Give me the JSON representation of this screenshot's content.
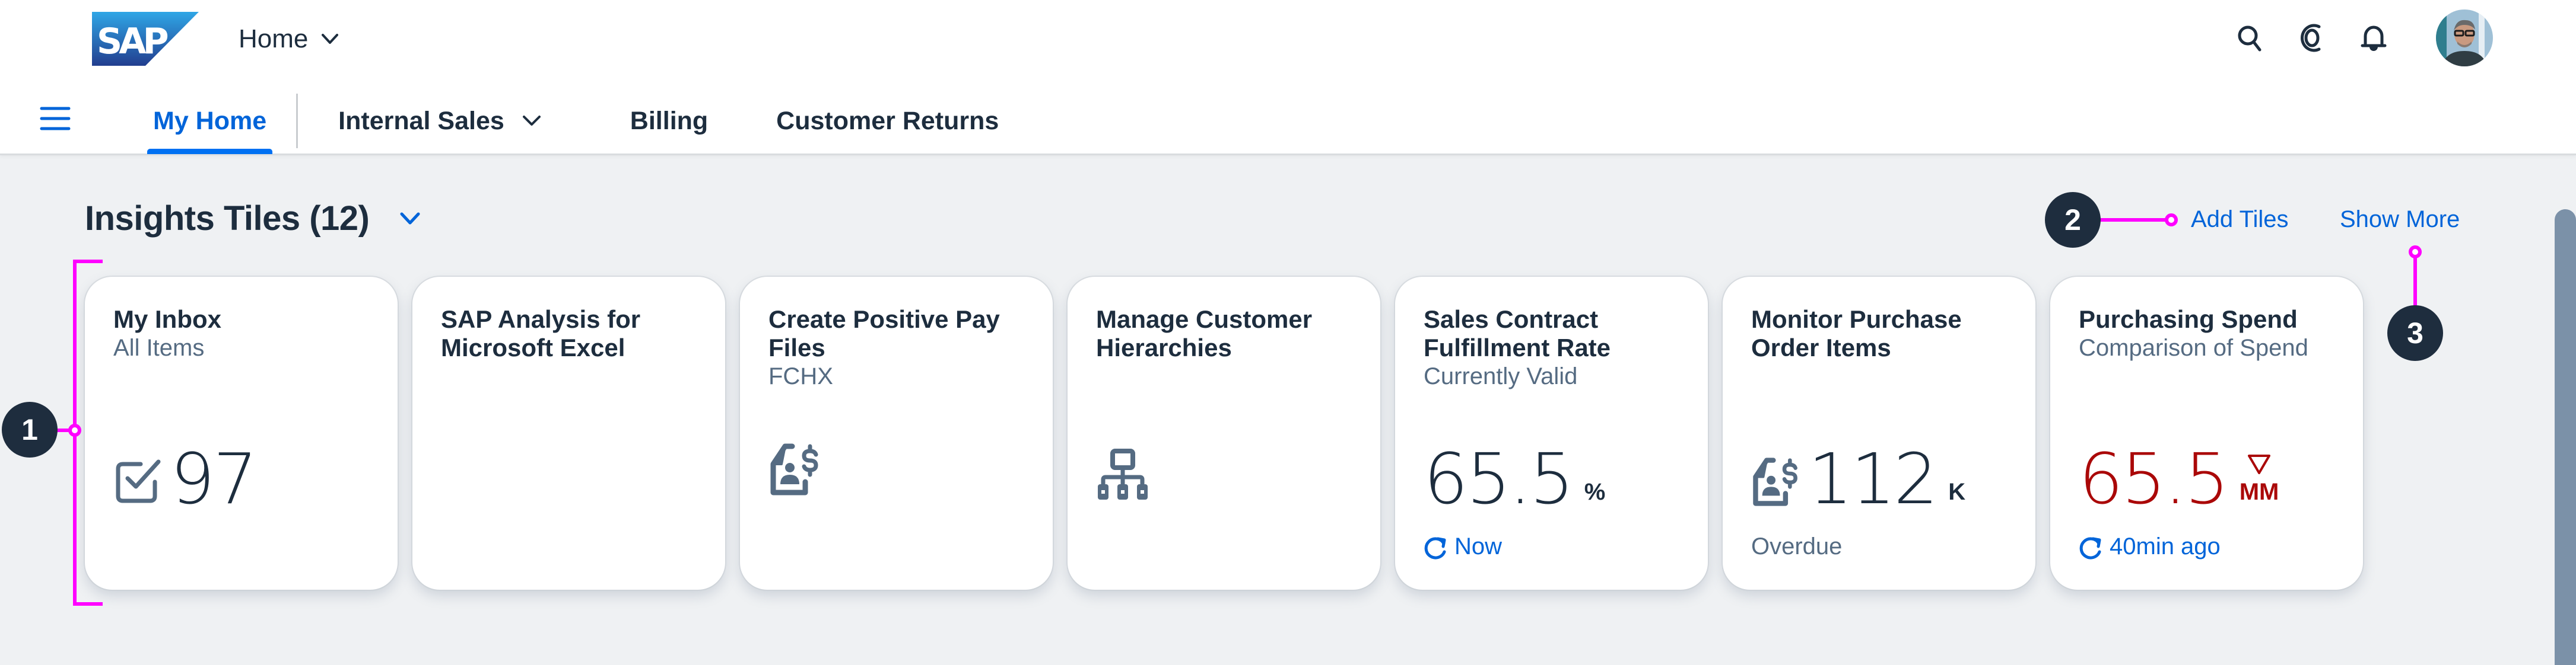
{
  "shell": {
    "logo": "SAP",
    "home_menu_label": "Home",
    "actions": [
      {
        "name": "search",
        "icon": "search-icon"
      },
      {
        "name": "joule",
        "icon": "joule-copilot-icon"
      },
      {
        "name": "notifications",
        "icon": "bell-icon"
      },
      {
        "name": "profile",
        "icon": "user-avatar"
      }
    ]
  },
  "nav": {
    "menu_icon": "hamburger-icon",
    "tabs": [
      {
        "label": "My Home",
        "active": true
      },
      {
        "label": "Internal Sales",
        "has_dropdown": true
      },
      {
        "label": "Billing"
      },
      {
        "label": "Customer Returns"
      }
    ]
  },
  "section": {
    "title": "Insights Tiles (12)",
    "add_tiles_label": "Add Tiles",
    "show_more_label": "Show More"
  },
  "tiles": [
    {
      "title": "My Inbox",
      "subtitle": "All Items",
      "icon": "checkbox-checked-icon",
      "value": "97"
    },
    {
      "title": "SAP Analysis for Microsoft Excel"
    },
    {
      "title": "Create Positive Pay Files",
      "subtitle": "FCHX",
      "icon": "payment-document-icon"
    },
    {
      "title": "Manage Customer Hierarchies",
      "icon": "org-hierarchy-icon"
    },
    {
      "title": "Sales Contract Fulfillment Rate",
      "subtitle": "Currently Valid",
      "value": "65.5",
      "unit": "%",
      "footer": "Now",
      "footer_icon": "refresh-icon"
    },
    {
      "title": "Monitor Purchase Order Items",
      "icon": "payment-document-icon",
      "value": "112",
      "unit": "K",
      "footer": "Overdue"
    },
    {
      "title": "Purchasing Spend",
      "subtitle": "Comparison of Spend",
      "value": "65.5",
      "unit": "MM",
      "trend": "down",
      "state": "negative",
      "footer": "40min ago",
      "footer_icon": "refresh-icon"
    }
  ],
  "annotations": [
    "1",
    "2",
    "3"
  ],
  "colors": {
    "brand_blue": "#0070f2",
    "link_blue": "#0064d9",
    "text_dark": "#1d2d3e",
    "text_muted": "#556b82",
    "negative_red": "#aa0808",
    "annotation_magenta": "#ff00ff",
    "background": "#eff1f3"
  }
}
